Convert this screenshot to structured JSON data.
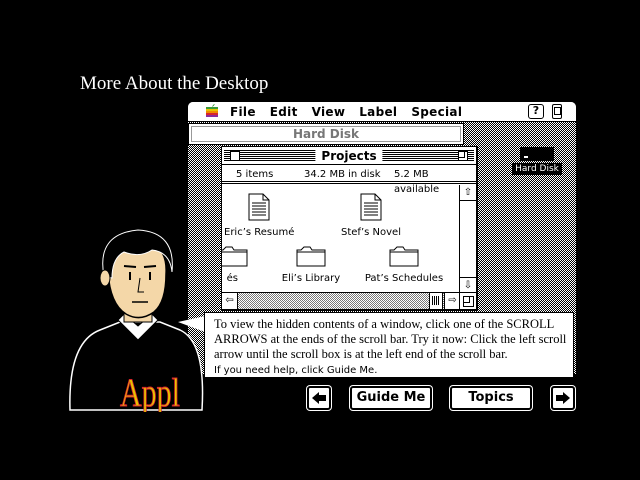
{
  "page": {
    "title": "More About the Desktop"
  },
  "menubar": {
    "items": [
      {
        "label": "File",
        "name": "menu-file"
      },
      {
        "label": "Edit",
        "name": "menu-edit"
      },
      {
        "label": "View",
        "name": "menu-view"
      },
      {
        "label": "Label",
        "name": "menu-label"
      },
      {
        "label": "Special",
        "name": "menu-special"
      }
    ],
    "help_icon_glyph": "?"
  },
  "hard_disk_window": {
    "title": "Hard Disk"
  },
  "desktop": {
    "hard_disk_icon_label": "Hard Disk"
  },
  "projects_window": {
    "title": "Projects",
    "info": {
      "items": "5 items",
      "in_disk": "34.2 MB in disk",
      "available": "5.2 MB available"
    },
    "files": [
      {
        "label": "Eric’s Resumé",
        "kind": "document"
      },
      {
        "label": "Stef’s Novel",
        "kind": "document"
      },
      {
        "label": "és",
        "kind": "folder"
      },
      {
        "label": "Eli’s Library",
        "kind": "folder"
      },
      {
        "label": "Pat’s Schedules",
        "kind": "folder"
      }
    ]
  },
  "instruction": {
    "text": "To view the hidden contents of a window, click one of the SCROLL ARROWS at the ends of the scroll bar. Try it now: Click the left scroll arrow until the scroll box is at the left end of the scroll bar.",
    "help_hint": "If you need help, click Guide Me."
  },
  "nav": {
    "guide_label": "Guide Me",
    "topics_label": "Topics"
  },
  "shirt_text": "Appl"
}
